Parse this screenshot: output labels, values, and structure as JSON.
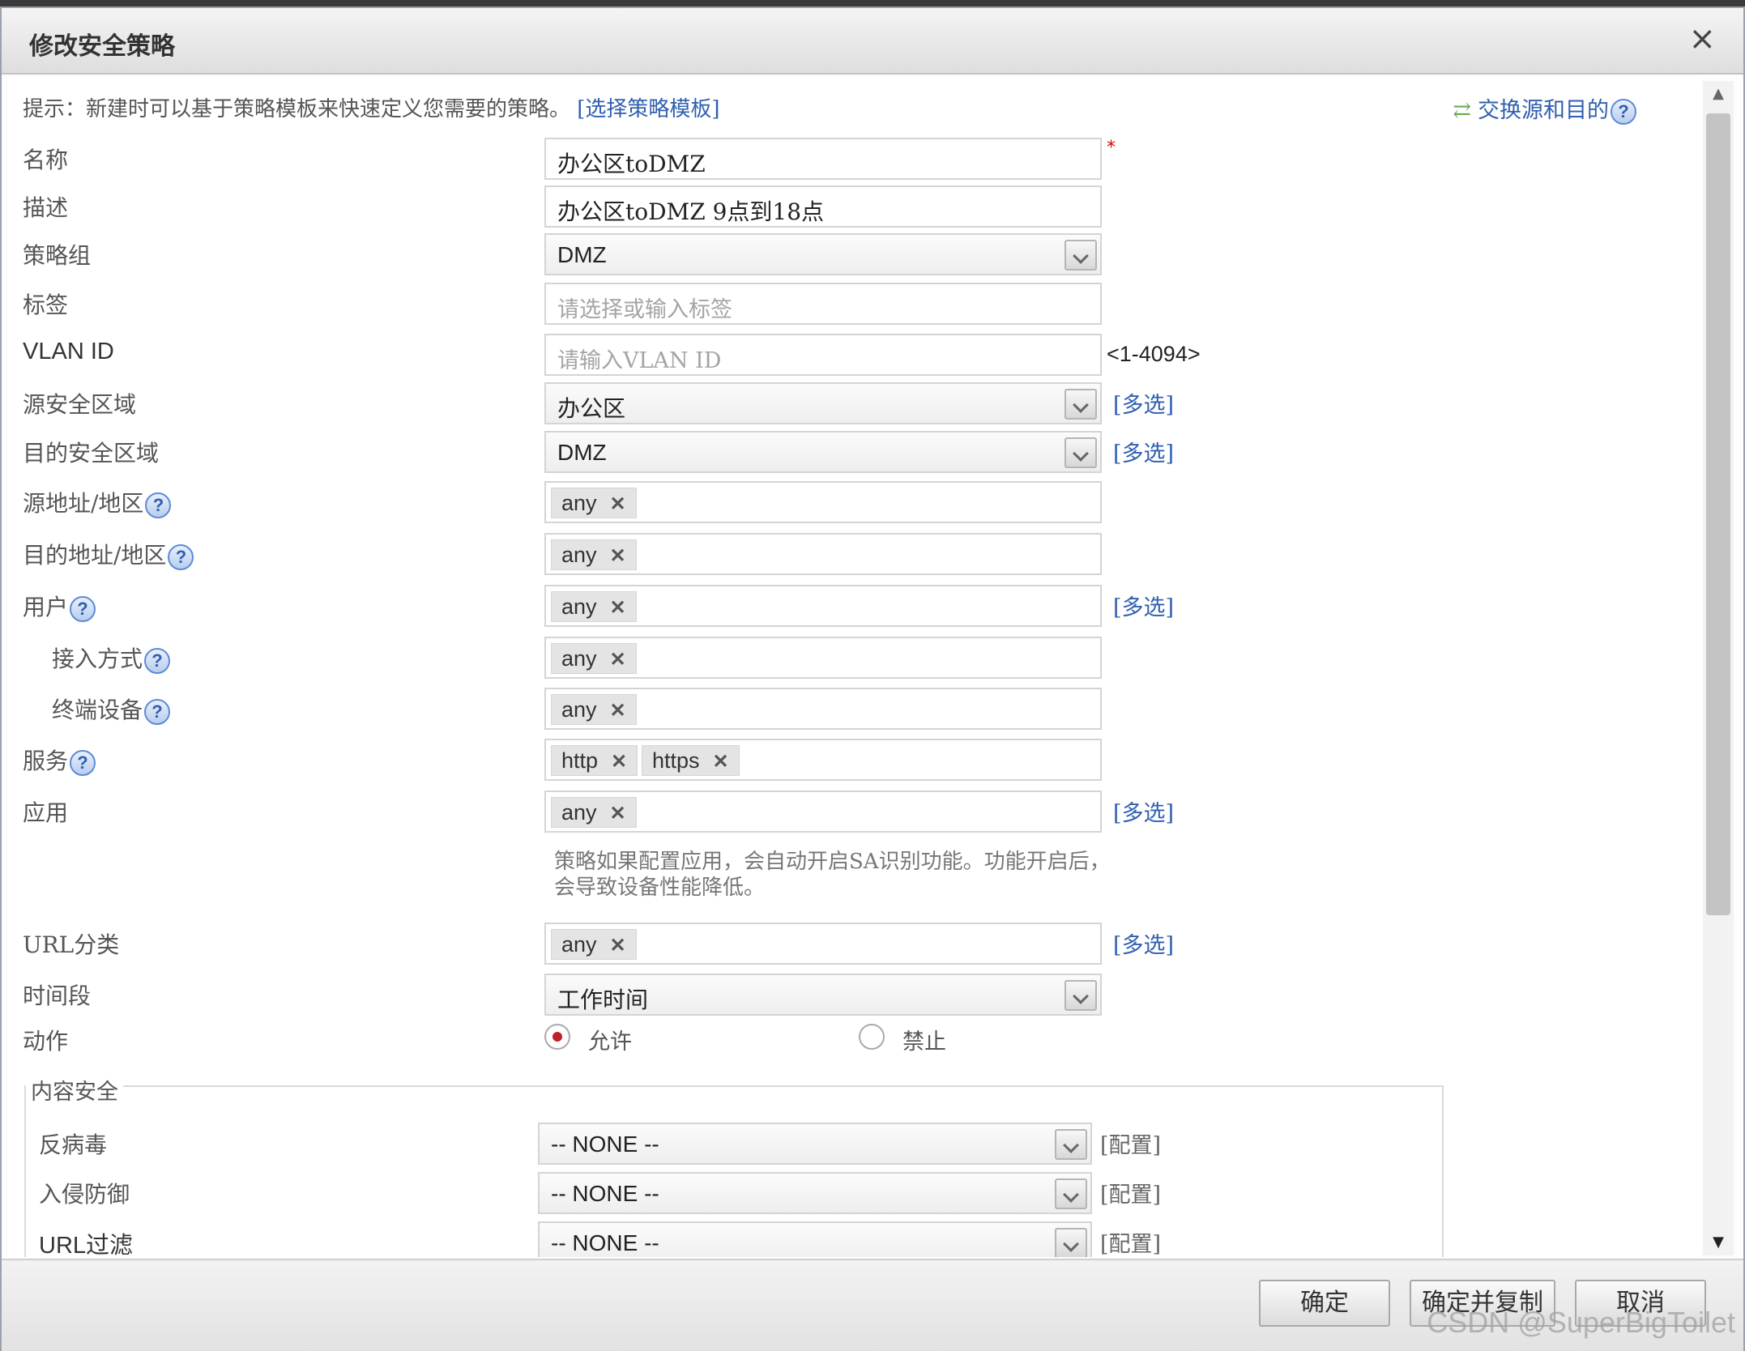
{
  "dialog": {
    "title": "修改安全策略",
    "close_label": "×"
  },
  "hint": {
    "prefix": "提示：新建时可以基于策略模板来快速定义您需要的策略。",
    "link": "[选择策略模板]",
    "swap_label": "交换源和目的"
  },
  "form": {
    "name": {
      "label": "名称",
      "value": "办公区toDMZ",
      "required_mark": "*"
    },
    "desc": {
      "label": "描述",
      "value": "办公区toDMZ 9点到18点"
    },
    "group": {
      "label": "策略组",
      "value": "DMZ"
    },
    "tag": {
      "label": "标签",
      "placeholder": "请选择或输入标签"
    },
    "vlan": {
      "label": "VLAN ID",
      "placeholder": "请输入VLAN ID",
      "range": "<1-4094>"
    },
    "src_zone": {
      "label": "源安全区域",
      "value": "办公区",
      "multi": "[多选]"
    },
    "dst_zone": {
      "label": "目的安全区域",
      "value": "DMZ",
      "multi": "[多选]"
    },
    "src_addr": {
      "label": "源地址/地区",
      "chips": [
        "any"
      ]
    },
    "dst_addr": {
      "label": "目的地址/地区",
      "chips": [
        "any"
      ]
    },
    "user": {
      "label": "用户",
      "chips": [
        "any"
      ],
      "multi": "[多选]"
    },
    "access": {
      "label": "接入方式",
      "chips": [
        "any"
      ]
    },
    "terminal": {
      "label": "终端设备",
      "chips": [
        "any"
      ]
    },
    "service": {
      "label": "服务",
      "chips": [
        "http",
        "https"
      ]
    },
    "app": {
      "label": "应用",
      "chips": [
        "any"
      ],
      "multi": "[多选]",
      "note": "策略如果配置应用，会自动开启SA识别功能。功能开启后，会导致设备性能降低。"
    },
    "url_cat": {
      "label": "URL分类",
      "chips": [
        "any"
      ],
      "multi": "[多选]"
    },
    "time": {
      "label": "时间段",
      "value": "工作时间"
    },
    "action": {
      "label": "动作",
      "allow": "允许",
      "deny": "禁止",
      "selected": "allow"
    }
  },
  "content_security": {
    "legend": "内容安全",
    "antivirus": {
      "label": "反病毒",
      "value": "-- NONE --",
      "config": "[配置]"
    },
    "ips": {
      "label": "入侵防御",
      "value": "-- NONE --",
      "config": "[配置]"
    },
    "url_filter": {
      "label": "URL过滤",
      "value": "-- NONE --",
      "config": "[配置]"
    }
  },
  "footer": {
    "ok": "确定",
    "ok_copy": "确定并复制",
    "cancel": "取消"
  },
  "chip_remove_glyph": "✕",
  "help_glyph": "?",
  "watermark": "CSDN @SuperBigToilet",
  "colors": {
    "link": "#2f5fb0",
    "required": "#d00000",
    "radio_on": "#c0202a"
  }
}
